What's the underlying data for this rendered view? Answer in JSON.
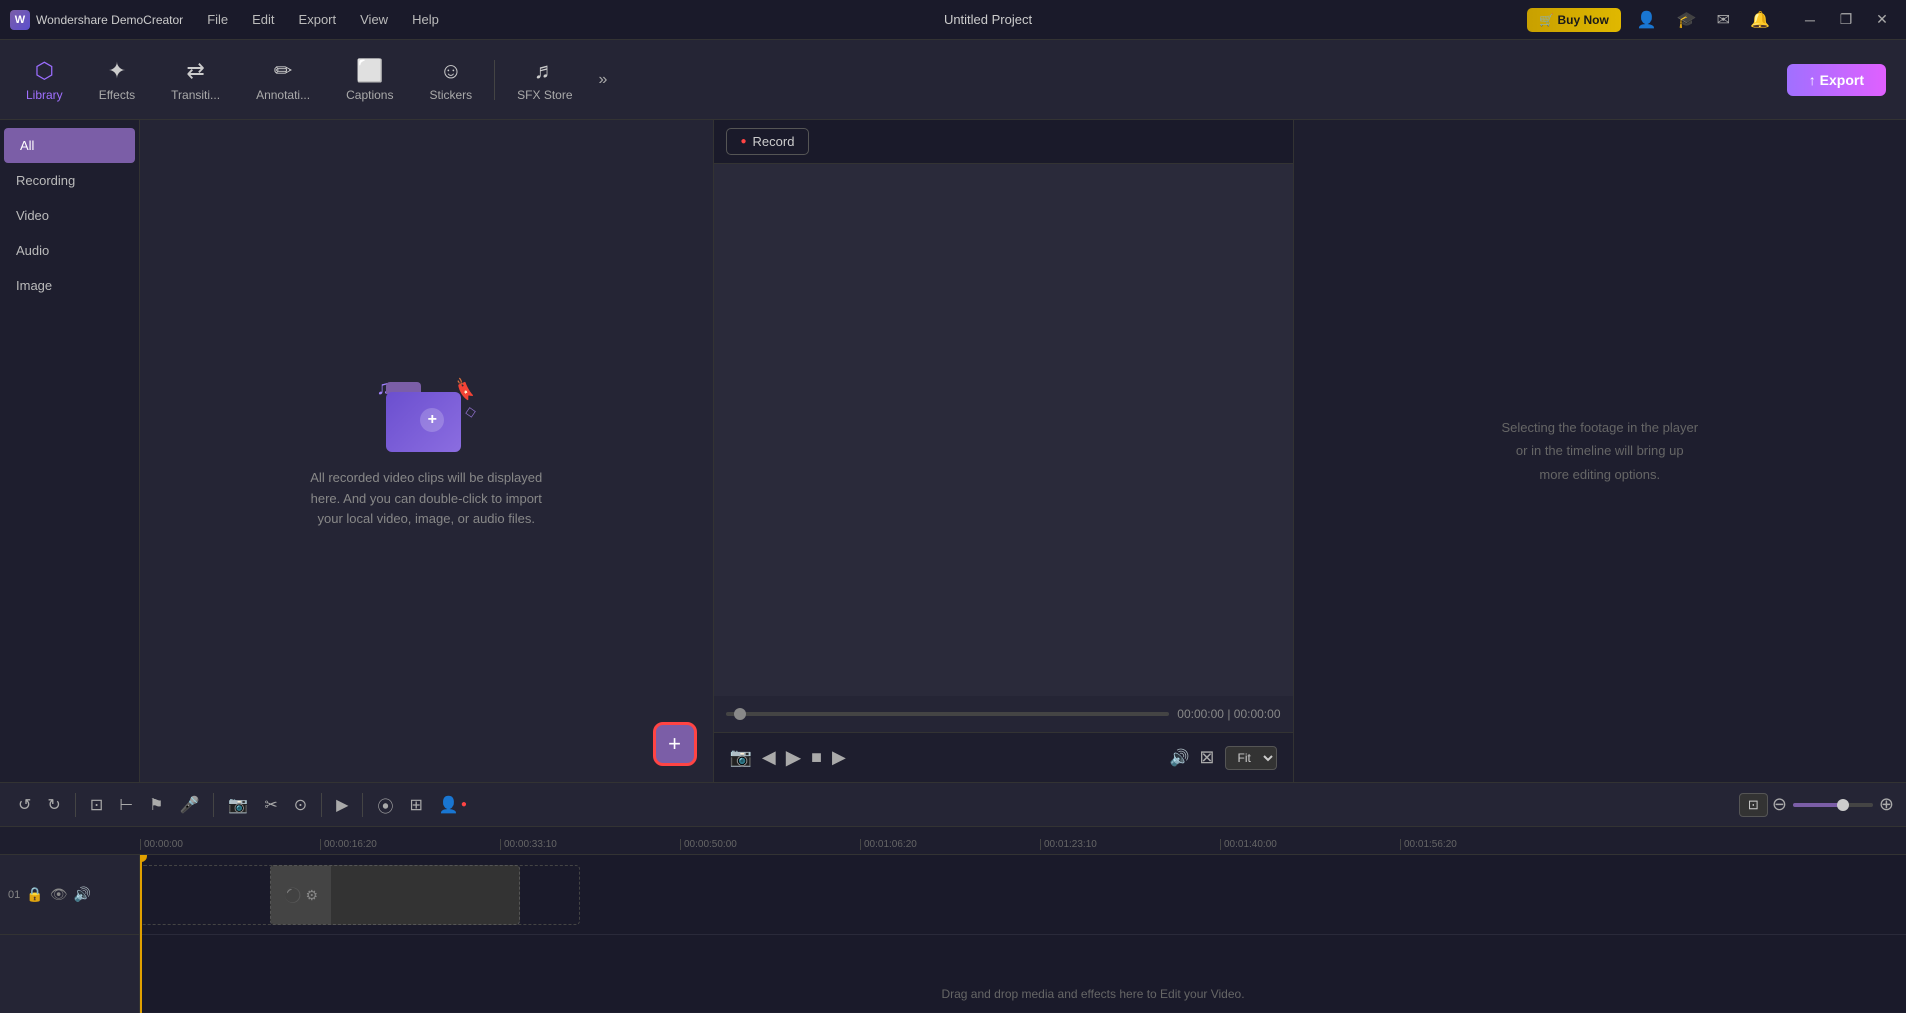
{
  "app": {
    "name": "Wondershare DemoCreator",
    "title": "Untitled Project"
  },
  "menu": {
    "items": [
      "File",
      "Edit",
      "Export",
      "View",
      "Help"
    ]
  },
  "buyNow": {
    "label": "🛒 Buy Now"
  },
  "export": {
    "label": "↑ Export"
  },
  "toolbar": {
    "items": [
      {
        "id": "library",
        "label": "Library",
        "icon": "⬡",
        "active": true
      },
      {
        "id": "effects",
        "label": "Effects",
        "icon": "✦"
      },
      {
        "id": "transitions",
        "label": "Transiti...",
        "icon": "⇄"
      },
      {
        "id": "annotations",
        "label": "Annotati...",
        "icon": "✏"
      },
      {
        "id": "captions",
        "label": "Captions",
        "icon": "⬜"
      },
      {
        "id": "stickers",
        "label": "Stickers",
        "icon": "☺"
      },
      {
        "id": "sfxstore",
        "label": "SFX Store",
        "icon": "♬"
      }
    ]
  },
  "sidebar": {
    "items": [
      {
        "id": "all",
        "label": "All",
        "active": true
      },
      {
        "id": "recording",
        "label": "Recording"
      },
      {
        "id": "video",
        "label": "Video"
      },
      {
        "id": "audio",
        "label": "Audio"
      },
      {
        "id": "image",
        "label": "Image"
      }
    ]
  },
  "mediaPanel": {
    "placeholder": "All recorded video clips will be displayed here. And you can double-click to import your local video, image, or audio files.",
    "addButton": "+"
  },
  "preview": {
    "recordButton": "Record",
    "timeLeft": "00:00:00",
    "timeSeparator": "|",
    "timeTotal": "00:00:00",
    "fitLabel": "Fit"
  },
  "propertiesPanel": {
    "hint": "Selecting the footage in the player or in the timeline will bring up more editing options."
  },
  "timeline": {
    "rulerMarks": [
      "00:00:00",
      "00:00:16:20",
      "00:00:33:10",
      "00:00:50:00",
      "00:01:06:20",
      "00:01:23:10",
      "00:01:40:00",
      "00:01:56:20"
    ],
    "dragDropText": "Drag and drop media and effects here to Edit your Video.",
    "trackNumber": "01"
  },
  "windowControls": {
    "minimize": "─",
    "maximize": "❐",
    "close": "✕"
  }
}
